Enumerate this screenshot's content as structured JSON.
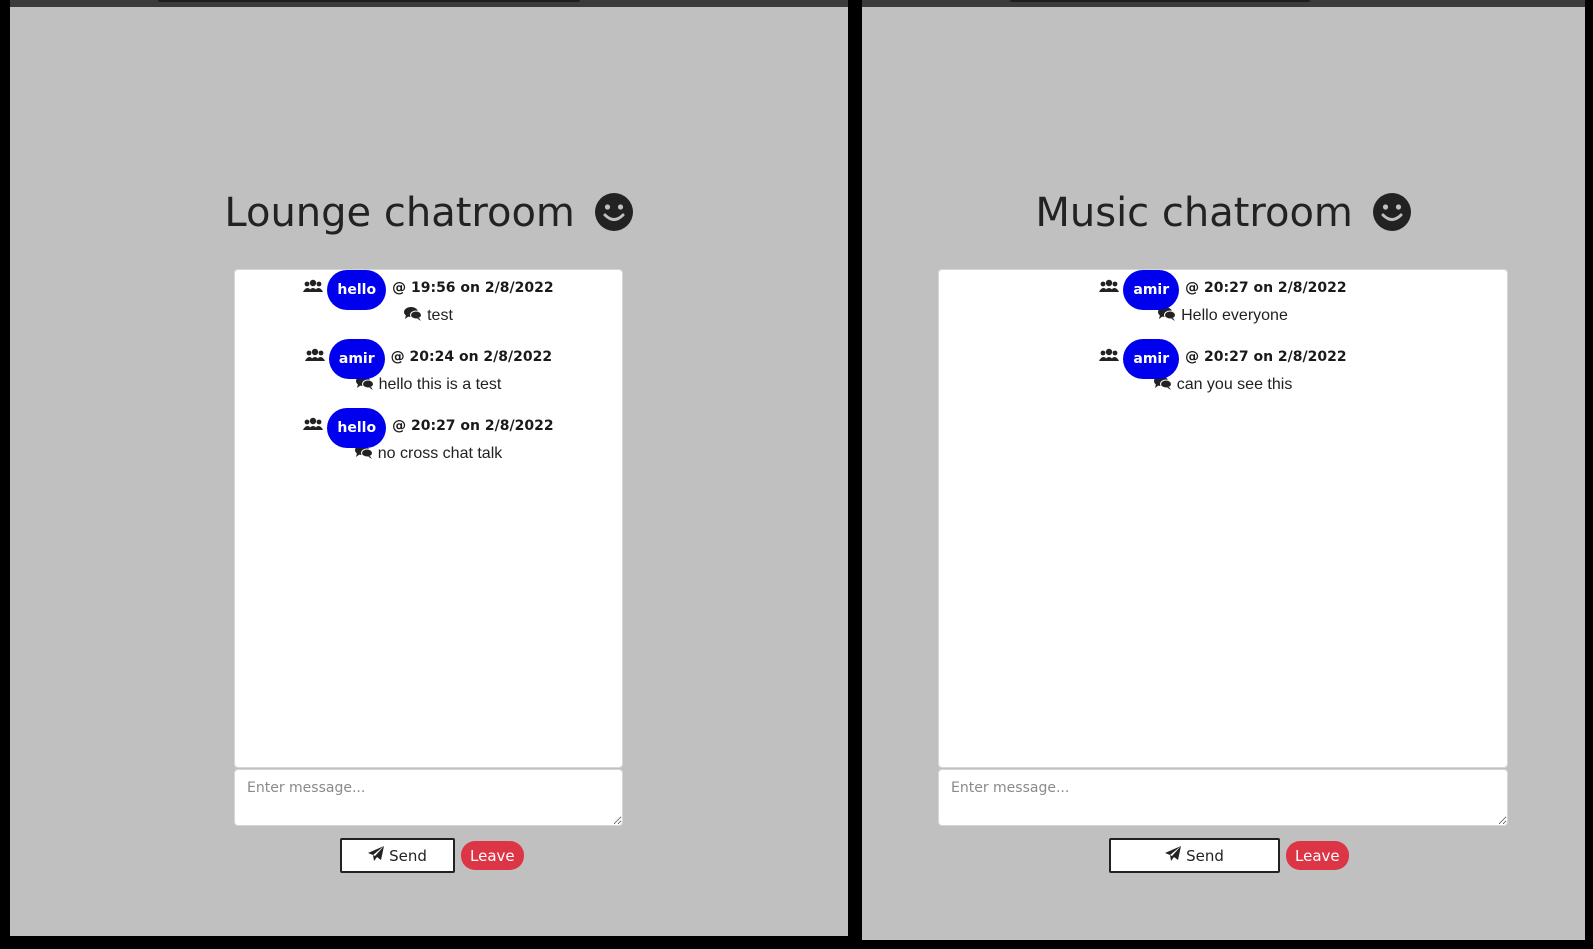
{
  "windows": [
    {
      "room_title": "Lounge chatroom",
      "messages": [
        {
          "user": "hello",
          "meta": "@ 19:56 on 2/8/2022",
          "text": "test"
        },
        {
          "user": "amir",
          "meta": "@ 20:24 on 2/8/2022",
          "text": "hello this is a test"
        },
        {
          "user": "hello",
          "meta": "@ 20:27 on 2/8/2022",
          "text": "no cross chat talk"
        }
      ],
      "input_placeholder": "Enter message...",
      "send_label": "Send",
      "leave_label": "Leave"
    },
    {
      "room_title": "Music chatroom",
      "messages": [
        {
          "user": "amir",
          "meta": "@ 20:27 on 2/8/2022",
          "text": "Hello everyone"
        },
        {
          "user": "amir",
          "meta": "@ 20:27 on 2/8/2022",
          "text": "can you see this"
        }
      ],
      "input_placeholder": "Enter message...",
      "send_label": "Send",
      "leave_label": "Leave"
    }
  ],
  "colors": {
    "background": "#c0c0c0",
    "user_badge": "#0000ee",
    "leave_button": "#dc3545"
  },
  "icons": [
    "smile-icon",
    "users-icon",
    "comments-icon",
    "paper-plane-icon"
  ]
}
